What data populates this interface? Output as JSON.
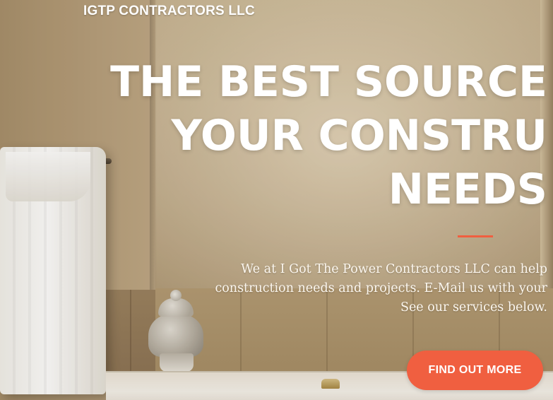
{
  "navbar": {
    "brand": "IGTP CONTRACTORS LLC"
  },
  "hero": {
    "headline_lines": [
      "THE BEST SOURCE",
      "YOUR CONSTRU",
      "NEEDS"
    ],
    "lead_lines": [
      "We at I Got The Power Contractors LLC can help",
      "construction needs and projects. E-Mail us with your",
      "See our services below."
    ],
    "cta_label": "FIND OUT MORE",
    "accent_color": "#f05f40"
  }
}
